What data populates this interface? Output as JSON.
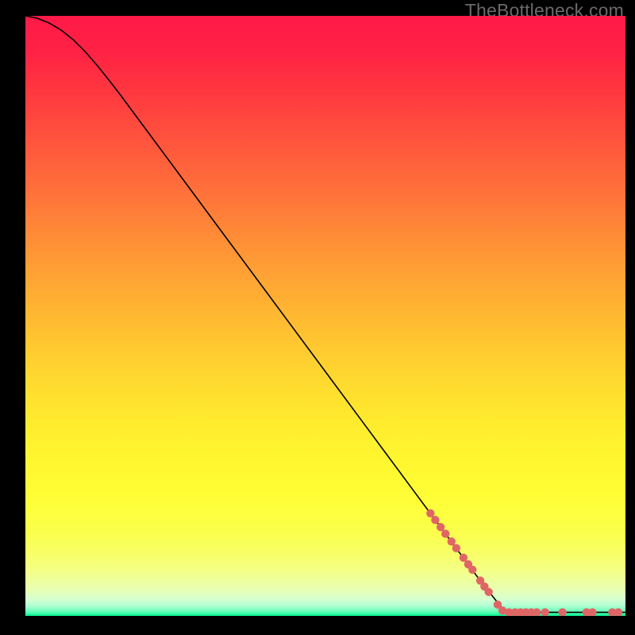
{
  "watermark": "TheBottleneck.com",
  "chart_data": {
    "type": "line",
    "title": "",
    "xlabel": "",
    "ylabel": "",
    "xlim": [
      0,
      100
    ],
    "ylim": [
      0,
      100
    ],
    "background_gradient_stops": [
      {
        "t": 0.0,
        "color": "#ff1948"
      },
      {
        "t": 0.06,
        "color": "#ff2244"
      },
      {
        "t": 0.12,
        "color": "#ff3540"
      },
      {
        "t": 0.18,
        "color": "#ff4a3e"
      },
      {
        "t": 0.24,
        "color": "#ff5f3c"
      },
      {
        "t": 0.3,
        "color": "#ff743a"
      },
      {
        "t": 0.36,
        "color": "#ff8937"
      },
      {
        "t": 0.42,
        "color": "#ff9e35"
      },
      {
        "t": 0.48,
        "color": "#ffb232"
      },
      {
        "t": 0.54,
        "color": "#ffc530"
      },
      {
        "t": 0.6,
        "color": "#ffd72f"
      },
      {
        "t": 0.66,
        "color": "#ffe72e"
      },
      {
        "t": 0.72,
        "color": "#fff42f"
      },
      {
        "t": 0.78,
        "color": "#fffb32"
      },
      {
        "t": 0.82,
        "color": "#feff3b"
      },
      {
        "t": 0.86,
        "color": "#fbff4c"
      },
      {
        "t": 0.9,
        "color": "#f7ff6a"
      },
      {
        "t": 0.93,
        "color": "#f2ff8e"
      },
      {
        "t": 0.955,
        "color": "#e9ffb2"
      },
      {
        "t": 0.972,
        "color": "#d7ffd0"
      },
      {
        "t": 0.982,
        "color": "#b6ffd5"
      },
      {
        "t": 0.99,
        "color": "#7dffc0"
      },
      {
        "t": 0.996,
        "color": "#3dffab"
      },
      {
        "t": 1.0,
        "color": "#00e588"
      }
    ],
    "series": [
      {
        "name": "bottleneck-curve",
        "color": "#000000",
        "width": 1.6,
        "points": [
          {
            "x": 0.0,
            "y": 100.0
          },
          {
            "x": 2.0,
            "y": 99.6
          },
          {
            "x": 4.0,
            "y": 98.8
          },
          {
            "x": 6.0,
            "y": 97.6
          },
          {
            "x": 8.0,
            "y": 96.0
          },
          {
            "x": 10.0,
            "y": 94.0
          },
          {
            "x": 12.0,
            "y": 91.7
          },
          {
            "x": 14.0,
            "y": 89.2
          },
          {
            "x": 16.0,
            "y": 86.6
          },
          {
            "x": 18.0,
            "y": 83.9
          },
          {
            "x": 20.0,
            "y": 81.2
          },
          {
            "x": 24.0,
            "y": 75.8
          },
          {
            "x": 28.0,
            "y": 70.4
          },
          {
            "x": 32.0,
            "y": 65.0
          },
          {
            "x": 36.0,
            "y": 59.6
          },
          {
            "x": 40.0,
            "y": 54.2
          },
          {
            "x": 44.0,
            "y": 48.8
          },
          {
            "x": 48.0,
            "y": 43.4
          },
          {
            "x": 52.0,
            "y": 38.0
          },
          {
            "x": 56.0,
            "y": 32.6
          },
          {
            "x": 60.0,
            "y": 27.2
          },
          {
            "x": 64.0,
            "y": 21.8
          },
          {
            "x": 68.0,
            "y": 16.4
          },
          {
            "x": 72.0,
            "y": 11.0
          },
          {
            "x": 76.0,
            "y": 5.6
          },
          {
            "x": 80.0,
            "y": 0.6
          },
          {
            "x": 82.0,
            "y": 0.6
          },
          {
            "x": 86.0,
            "y": 0.6
          },
          {
            "x": 90.0,
            "y": 0.6
          },
          {
            "x": 94.0,
            "y": 0.6
          },
          {
            "x": 98.0,
            "y": 0.6
          },
          {
            "x": 100.0,
            "y": 0.6
          }
        ]
      }
    ],
    "highlight_points": {
      "color": "#e06666",
      "radius": 5.2,
      "points": [
        {
          "x": 67.5,
          "y": 17.1
        },
        {
          "x": 68.3,
          "y": 16.0
        },
        {
          "x": 69.2,
          "y": 14.8
        },
        {
          "x": 70.0,
          "y": 13.7
        },
        {
          "x": 71.0,
          "y": 12.4
        },
        {
          "x": 71.8,
          "y": 11.3
        },
        {
          "x": 73.0,
          "y": 9.7
        },
        {
          "x": 73.8,
          "y": 8.6
        },
        {
          "x": 74.5,
          "y": 7.7
        },
        {
          "x": 75.8,
          "y": 5.9
        },
        {
          "x": 76.5,
          "y": 4.9
        },
        {
          "x": 77.2,
          "y": 4.0
        },
        {
          "x": 78.7,
          "y": 1.9
        },
        {
          "x": 79.5,
          "y": 0.9
        },
        {
          "x": 80.6,
          "y": 0.6
        },
        {
          "x": 81.6,
          "y": 0.6
        },
        {
          "x": 82.5,
          "y": 0.6
        },
        {
          "x": 83.4,
          "y": 0.6
        },
        {
          "x": 84.3,
          "y": 0.6
        },
        {
          "x": 85.2,
          "y": 0.6
        },
        {
          "x": 86.6,
          "y": 0.6
        },
        {
          "x": 89.5,
          "y": 0.6
        },
        {
          "x": 93.5,
          "y": 0.6
        },
        {
          "x": 94.5,
          "y": 0.6
        },
        {
          "x": 97.8,
          "y": 0.6
        },
        {
          "x": 98.8,
          "y": 0.6
        }
      ]
    }
  }
}
